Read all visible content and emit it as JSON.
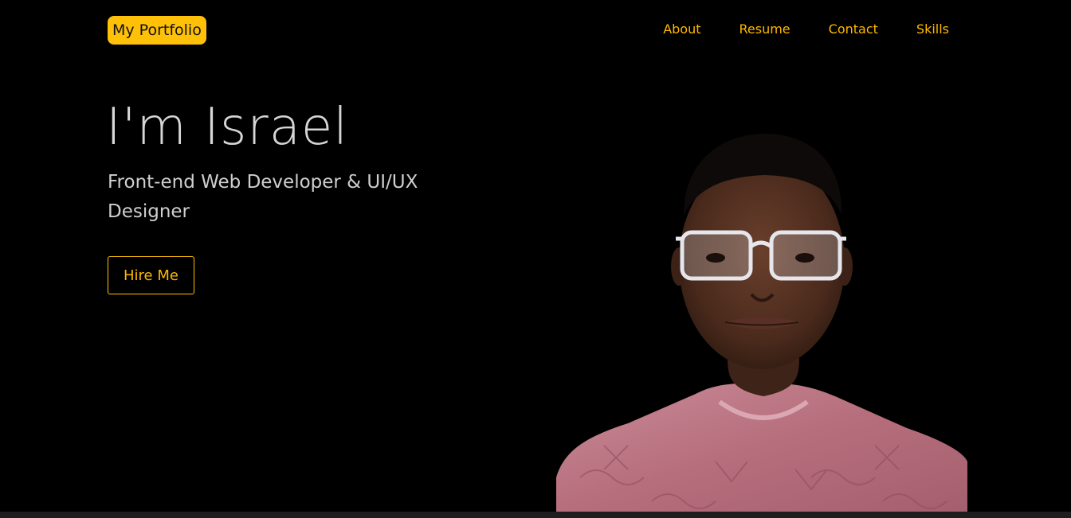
{
  "nav": {
    "logo": "My Portfolio",
    "links": [
      "About",
      "Resume",
      "Contact",
      "Skills"
    ]
  },
  "hero": {
    "title": "I'm Israel",
    "subtitle": "Front-end Web Developer & UI/UX Designer",
    "cta_label": "Hire Me"
  },
  "colors": {
    "accent": "#ffc107",
    "link": "#ffb800",
    "background": "#000000",
    "text": "#d6d6d6"
  },
  "icons": {
    "portrait": "profile-photo"
  }
}
